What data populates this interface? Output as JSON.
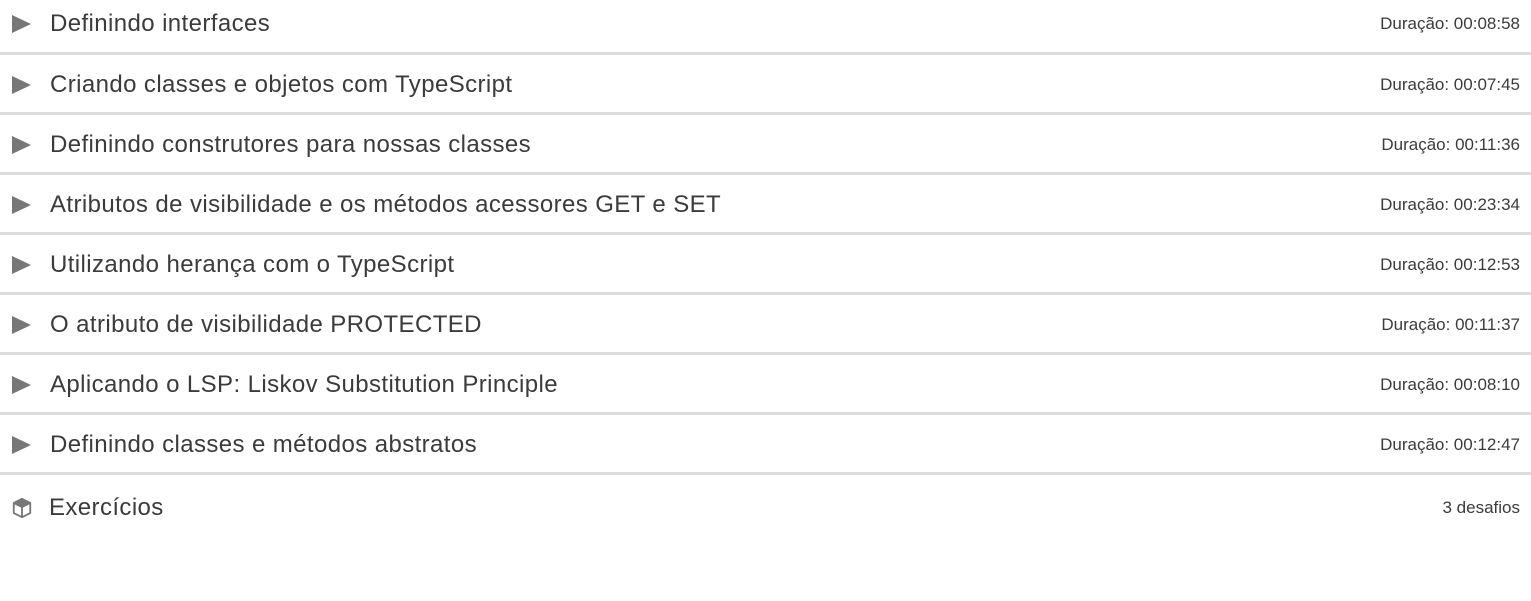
{
  "lessons": [
    {
      "title": "Definindo interfaces",
      "duration": "Duração: 00:08:58"
    },
    {
      "title": "Criando classes e objetos com TypeScript",
      "duration": "Duração: 00:07:45"
    },
    {
      "title": "Definindo construtores para nossas classes",
      "duration": "Duração: 00:11:36"
    },
    {
      "title": "Atributos de visibilidade e os métodos acessores GET e SET",
      "duration": "Duração: 00:23:34"
    },
    {
      "title": "Utilizando herança com o TypeScript",
      "duration": "Duração: 00:12:53"
    },
    {
      "title": "O atributo de visibilidade PROTECTED",
      "duration": "Duração: 00:11:37"
    },
    {
      "title": "Aplicando o LSP: Liskov Substitution Principle",
      "duration": "Duração: 00:08:10"
    },
    {
      "title": "Definindo classes e métodos abstratos",
      "duration": "Duração: 00:12:47"
    }
  ],
  "exercises": {
    "title": "Exercícios",
    "count": "3 desafios",
    "icon": "cube-icon"
  },
  "lesson_icon": "play-icon"
}
